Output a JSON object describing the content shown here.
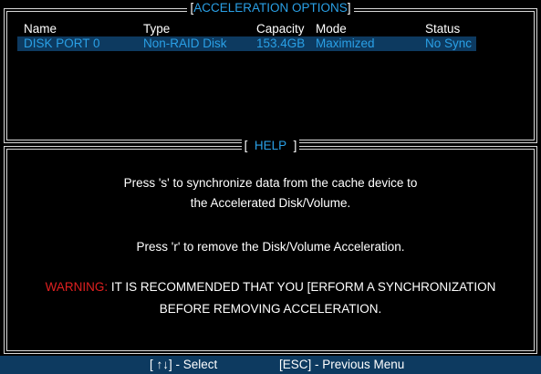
{
  "top_panel": {
    "title": "ACCELERATION OPTIONS",
    "columns": [
      "Name",
      "Type",
      "Capacity",
      "Mode",
      "Status"
    ],
    "row": {
      "name": "DISK PORT 0",
      "type": "Non-RAID Disk",
      "capacity": "153.4GB",
      "mode": "Maximized",
      "status": "No Sync"
    }
  },
  "help_panel": {
    "title": "HELP",
    "line1": "Press 's' to synchronize data from the cache device to",
    "line2": "the Accelerated Disk/Volume.",
    "line3": "Press 'r' to remove the Disk/Volume Acceleration.",
    "warning_label": "WARNING:",
    "warning_text": " IT IS RECOMMENDED THAT YOU [ERFORM A SYNCHRONIZATION",
    "line5": "BEFORE REMOVING ACCELERATION."
  },
  "footer": {
    "select_hint": "[ ↑↓] - Select",
    "esc_hint": "[ESC] - Previous Menu"
  },
  "colors": {
    "accent": "#2aa0e6",
    "highlight_bg": "#0d3a60",
    "warning": "#e02020"
  }
}
